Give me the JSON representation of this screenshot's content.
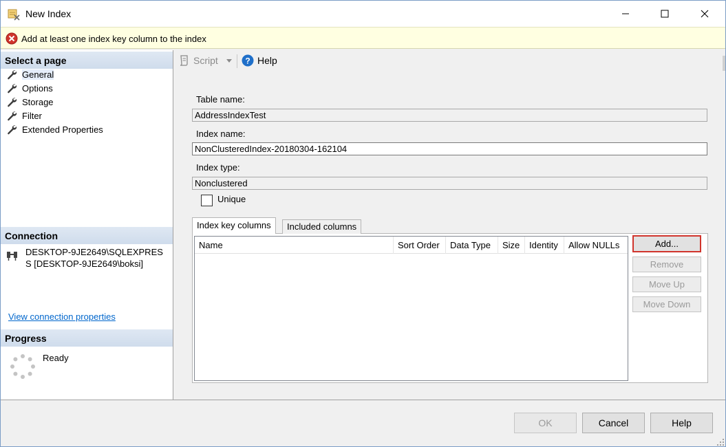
{
  "window": {
    "title": "New Index",
    "icon": "ssms-index-icon",
    "controls": {
      "minimize": "minimize-icon",
      "maximize": "maximize-icon",
      "close": "close-icon"
    }
  },
  "banner": {
    "message": "Add at least one index key column to the index",
    "icon": "error-icon",
    "color": "#d0342c"
  },
  "left": {
    "select_page_heading": "Select a page",
    "pages": [
      {
        "label": "General",
        "icon": "wrench-icon",
        "selected": true
      },
      {
        "label": "Options",
        "icon": "wrench-icon"
      },
      {
        "label": "Storage",
        "icon": "wrench-icon"
      },
      {
        "label": "Filter",
        "icon": "wrench-icon"
      },
      {
        "label": "Extended Properties",
        "icon": "wrench-icon"
      }
    ],
    "connection_heading": "Connection",
    "connection_text": "DESKTOP-9JE2649\\SQLEXPRESS [DESKTOP-9JE2649\\boksi]",
    "connection_icon": "server-connection-icon",
    "view_connection_link": "View connection properties",
    "progress_heading": "Progress",
    "progress_status": "Ready",
    "progress_icon": "spinner-icon"
  },
  "toolbar": {
    "script_label": "Script",
    "script_icon": "script-icon",
    "help_label": "Help",
    "help_icon": "help-icon"
  },
  "form": {
    "table_name_label": "Table name:",
    "table_name_value": "AddressIndexTest",
    "index_name_label": "Index name:",
    "index_name_value": "NonClusteredIndex-20180304-162104",
    "index_type_label": "Index type:",
    "index_type_value": "Nonclustered",
    "unique_label": "Unique",
    "unique_checked": false
  },
  "tabs": [
    {
      "label": "Index key columns",
      "active": true
    },
    {
      "label": "Included columns",
      "active": false
    }
  ],
  "grid": {
    "columns": [
      "Name",
      "Sort Order",
      "Data Type",
      "Size",
      "Identity",
      "Allow NULLs"
    ],
    "rows": []
  },
  "side_buttons": {
    "add": "Add...",
    "remove": "Remove",
    "move_up": "Move Up",
    "move_down": "Move Down"
  },
  "footer": {
    "ok": "OK",
    "cancel": "Cancel",
    "help": "Help"
  }
}
